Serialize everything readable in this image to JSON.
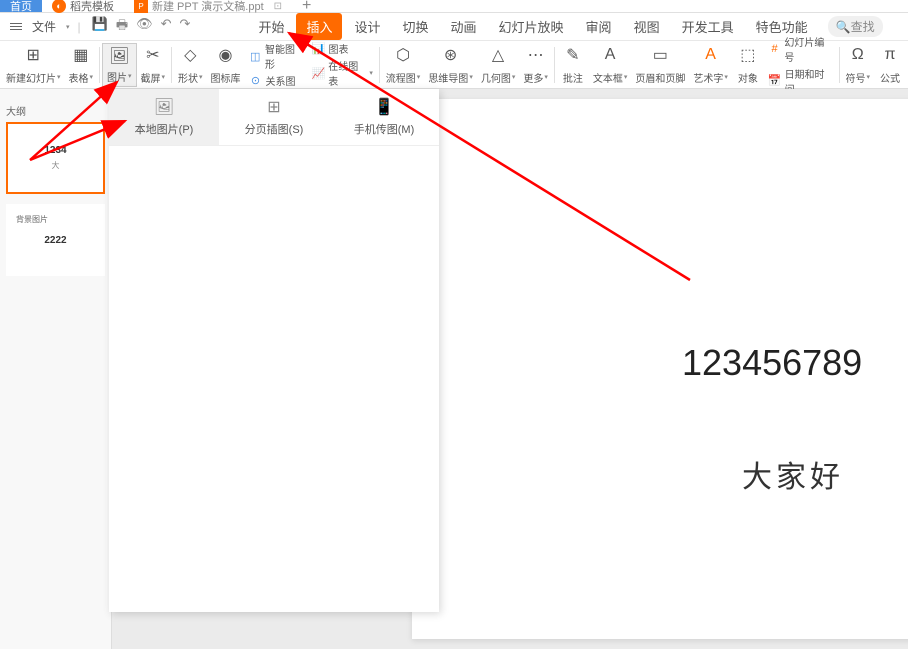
{
  "tabs": {
    "home": "首页",
    "docker": "稻壳模板",
    "file": "新建 PPT 演示文稿.ppt",
    "new": "+"
  },
  "menu": {
    "file_label": "文件",
    "tabs": [
      "开始",
      "插入",
      "设计",
      "切换",
      "动画",
      "幻灯片放映",
      "审阅",
      "视图",
      "开发工具",
      "特色功能"
    ],
    "active_tab_index": 1,
    "search": "查找"
  },
  "ribbon": {
    "items": [
      {
        "label": "新建幻灯片",
        "icon": "⊞"
      },
      {
        "label": "表格",
        "icon": "▦"
      },
      {
        "label": "图片",
        "icon": "🖼"
      },
      {
        "label": "截屏",
        "icon": "✂"
      },
      {
        "label": "形状",
        "icon": "◇"
      },
      {
        "label": "图标库",
        "icon": "◉"
      }
    ],
    "stack1": [
      {
        "label": "智能图形",
        "icon": "◫"
      },
      {
        "label": "关系图",
        "icon": "⊙"
      }
    ],
    "stack2": [
      {
        "label": "图表",
        "icon": "📊"
      },
      {
        "label": "在线图表",
        "icon": "📈"
      }
    ],
    "items2": [
      {
        "label": "流程图",
        "icon": "⬡"
      },
      {
        "label": "思维导图",
        "icon": "⊛"
      },
      {
        "label": "几何图",
        "icon": "△"
      },
      {
        "label": "更多",
        "icon": "⋯"
      },
      {
        "label": "批注",
        "icon": "✎"
      },
      {
        "label": "文本框",
        "icon": "A"
      },
      {
        "label": "页眉和页脚",
        "icon": "▭"
      },
      {
        "label": "艺术字",
        "icon": "A"
      },
      {
        "label": "对象",
        "icon": "⬚"
      }
    ],
    "stack3": [
      {
        "label": "幻灯片编号",
        "icon": "#"
      },
      {
        "label": "日期和时间",
        "icon": "📅"
      }
    ],
    "items3": [
      {
        "label": "符号",
        "icon": "Ω"
      },
      {
        "label": "公式",
        "icon": "π"
      }
    ]
  },
  "dropdown": {
    "options": [
      {
        "label": "本地图片(P)",
        "icon": "🖼"
      },
      {
        "label": "分页插图(S)",
        "icon": "⊞"
      },
      {
        "label": "手机传图(M)",
        "icon": "📱"
      }
    ]
  },
  "sidebar": {
    "outline_label": "大纲",
    "slides": [
      {
        "text": "1234",
        "sub": "大"
      },
      {
        "text": "2222",
        "bg_label": "背景图片"
      }
    ]
  },
  "canvas": {
    "title": "123456789",
    "subtitle": "大家好"
  }
}
